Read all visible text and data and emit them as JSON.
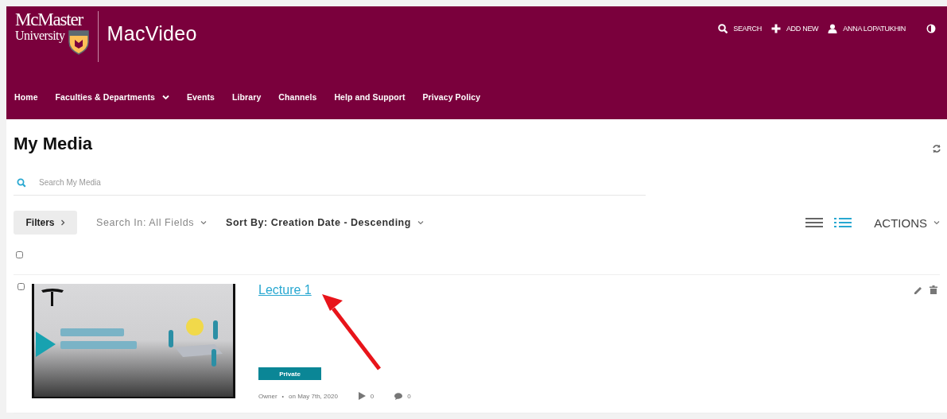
{
  "header": {
    "logo_top": "McMaster",
    "logo_bottom": "University",
    "site_title": "MacVideo",
    "top_links": [
      {
        "kind": "search",
        "label": "SEARCH"
      },
      {
        "kind": "add",
        "label": "ADD NEW"
      },
      {
        "kind": "user",
        "label": "ANNA LOPATUKHIN"
      },
      {
        "kind": "contrast"
      }
    ],
    "nav": [
      {
        "label": "Home",
        "dropdown": false
      },
      {
        "label": "Faculties & Departments",
        "dropdown": true
      },
      {
        "label": "Events",
        "dropdown": false
      },
      {
        "label": "Library",
        "dropdown": false
      },
      {
        "label": "Channels",
        "dropdown": false
      },
      {
        "label": "Help and Support",
        "dropdown": false
      },
      {
        "label": "Privacy Policy",
        "dropdown": false
      }
    ]
  },
  "page_title": "My Media",
  "search": {
    "placeholder": "Search My Media"
  },
  "toolbar": {
    "filters": "Filters",
    "search_in": "Search In: All Fields",
    "sort_by": "Sort By: Creation Date - Descending",
    "actions": "ACTIONS",
    "view_modes": [
      {
        "kind": "compact",
        "selected": false
      },
      {
        "kind": "detailed",
        "selected": true
      }
    ]
  },
  "select_all": {
    "checked": false
  },
  "media": [
    {
      "checked": false,
      "title": "Lecture 1",
      "status": "Private",
      "owner": "Owner",
      "separator": "•",
      "date": "on May 7th, 2020",
      "plays": "0",
      "comments": "0"
    }
  ],
  "annotation": {
    "kind": "arrow",
    "color": "#e8141a"
  }
}
